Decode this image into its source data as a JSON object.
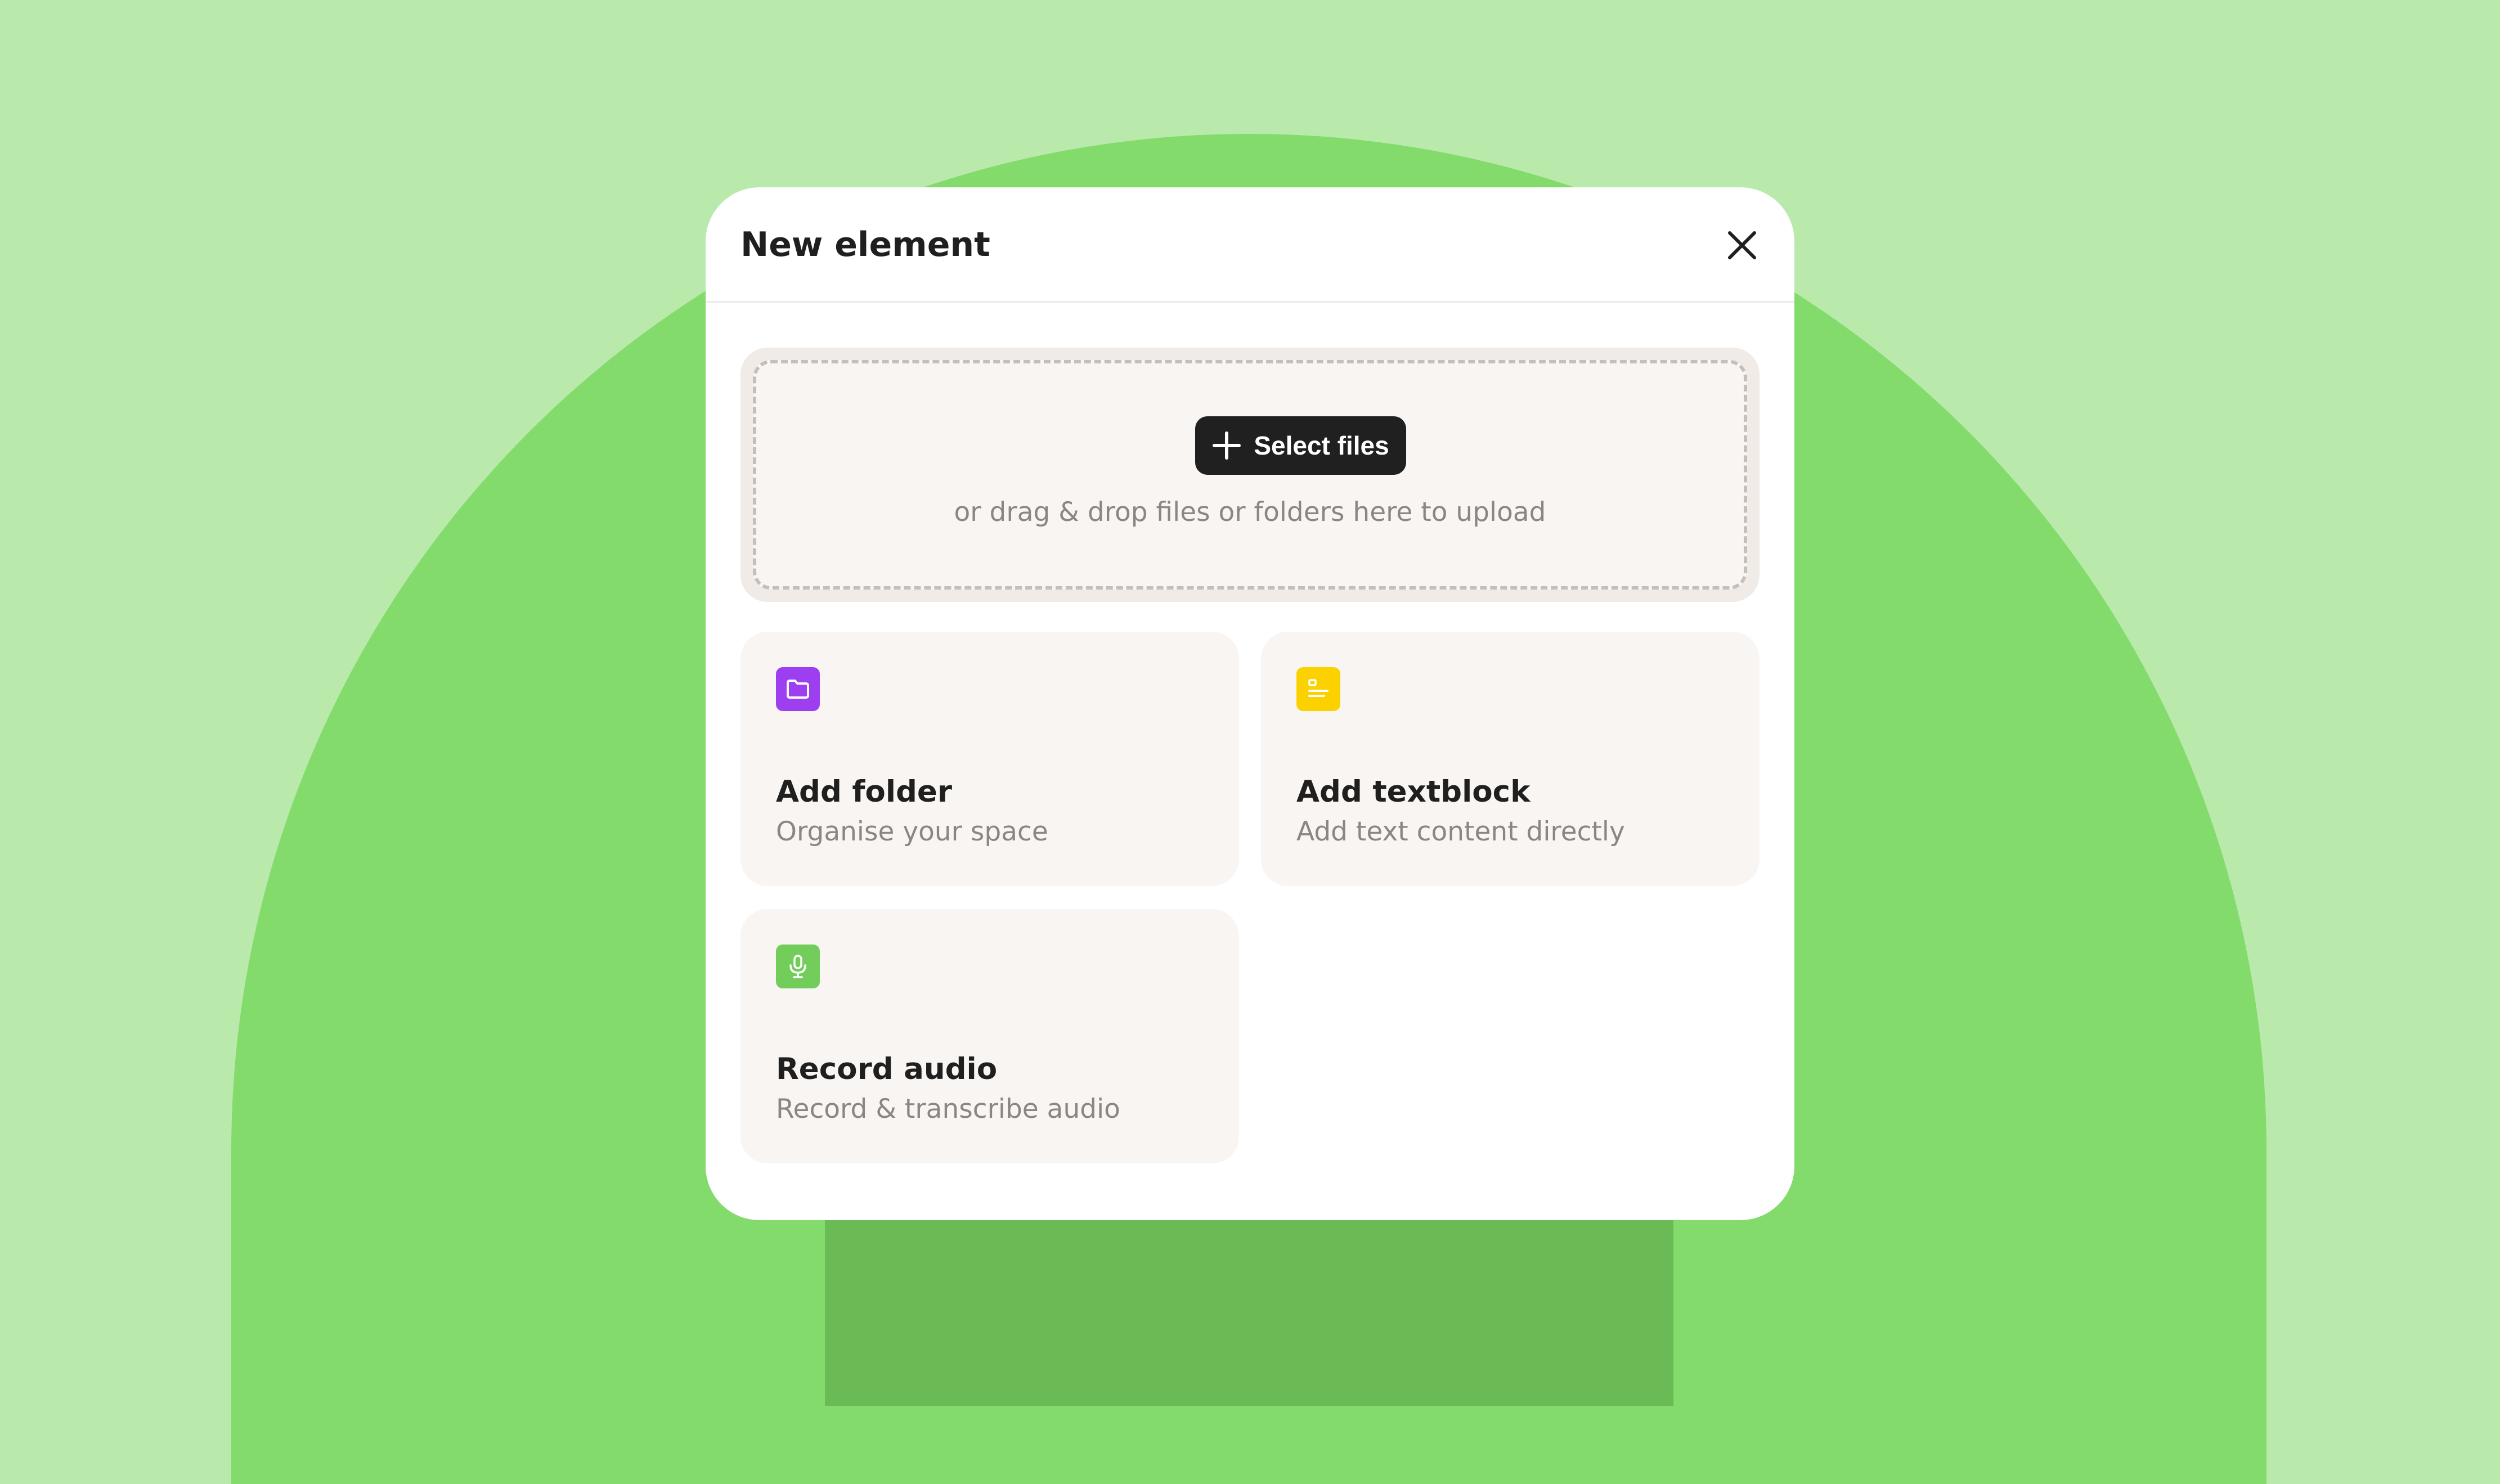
{
  "dialog": {
    "title": "New element",
    "close_icon": "close-icon"
  },
  "upload": {
    "button_label": "Select files",
    "button_icon": "plus-icon",
    "hint": "or drag & drop files or folders here to upload"
  },
  "options": [
    {
      "title": "Add folder",
      "subtitle": "Organise your space",
      "icon": "folder-icon",
      "color": "#9d3ff0"
    },
    {
      "title": "Add textblock",
      "subtitle": "Add text content directly",
      "icon": "textblock-icon",
      "color": "#fbd200"
    },
    {
      "title": "Record audio",
      "subtitle": "Record & transcribe audio",
      "icon": "microphone-icon",
      "color": "#72cd5b"
    }
  ],
  "colors": {
    "background": "#b9eaac",
    "arch": "#83db6b",
    "column": "#6aba56",
    "button": "#202020",
    "card": "#f9f5f2"
  }
}
